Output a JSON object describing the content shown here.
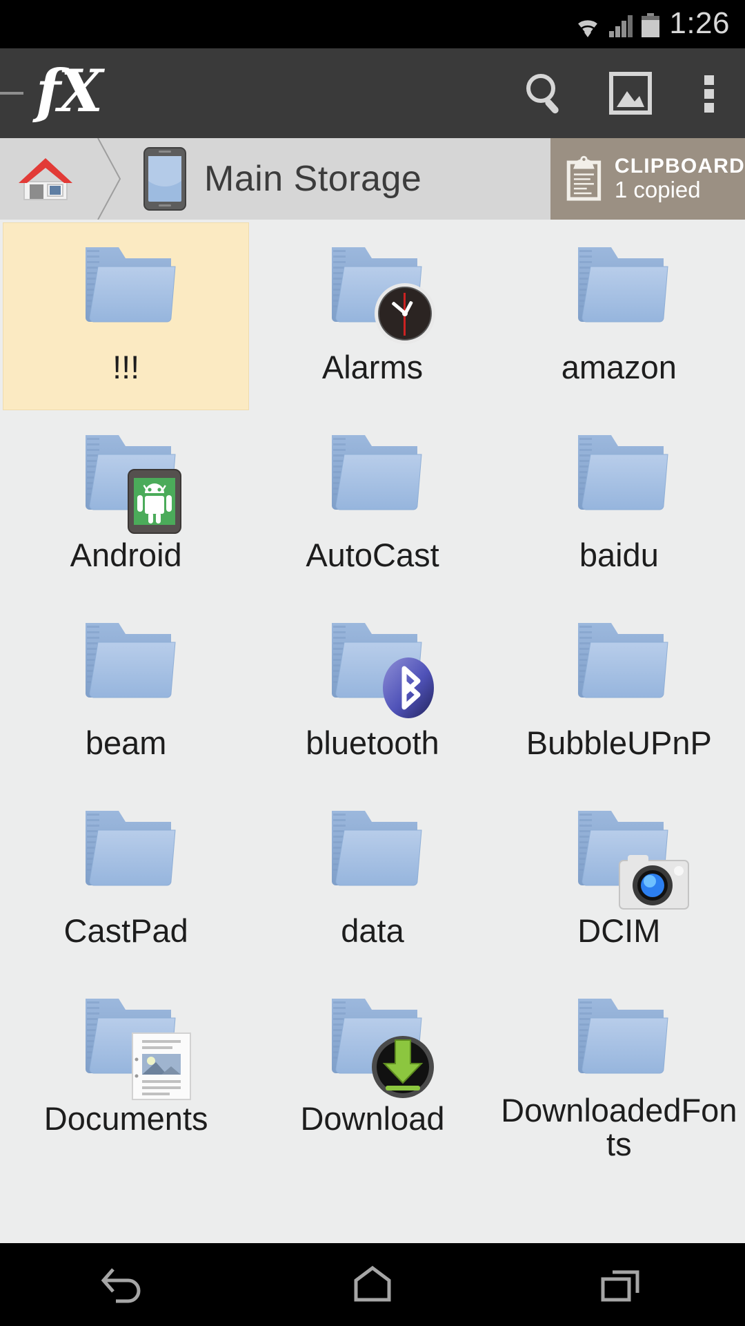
{
  "status_bar": {
    "time": "1:26",
    "icons": [
      "wifi-icon",
      "signal-icon",
      "battery-icon"
    ]
  },
  "action_bar": {
    "up_indicator": "up-dash",
    "app_logo_text": "fX",
    "actions": [
      {
        "name": "search-icon",
        "label": "Search"
      },
      {
        "name": "gallery-icon",
        "label": "Image viewer"
      },
      {
        "name": "overflow-menu-icon",
        "label": "More options"
      }
    ]
  },
  "breadcrumb": {
    "home_icon": "home-icon",
    "separator": "chevron-right-icon",
    "device_icon": "phone-icon",
    "current_path_label": "Main Storage"
  },
  "clipboard": {
    "icon": "clipboard-icon",
    "title": "CLIPBOARD",
    "subtitle": "1 copied"
  },
  "colors": {
    "status_bar_bg": "#000000",
    "action_bar_bg": "#3a3a3a",
    "breadcrumb_bg": "#d6d6d6",
    "clipboard_bg": "#9b9083",
    "grid_bg": "#eceded",
    "selection_bg": "#fbeac2",
    "folder_blue": "#a9c3e4",
    "nav_bar_bg": "#000000"
  },
  "files": [
    {
      "name": "!!!",
      "type": "folder",
      "badge": "none",
      "selected": true
    },
    {
      "name": "Alarms",
      "type": "folder",
      "badge": "clock-icon",
      "selected": false
    },
    {
      "name": "amazon",
      "type": "folder",
      "badge": "none",
      "selected": false
    },
    {
      "name": "Android",
      "type": "folder",
      "badge": "android-icon",
      "selected": false
    },
    {
      "name": "AutoCast",
      "type": "folder",
      "badge": "none",
      "selected": false
    },
    {
      "name": "baidu",
      "type": "folder",
      "badge": "none",
      "selected": false
    },
    {
      "name": "beam",
      "type": "folder",
      "badge": "none",
      "selected": false
    },
    {
      "name": "bluetooth",
      "type": "folder",
      "badge": "bluetooth-icon",
      "selected": false
    },
    {
      "name": "BubbleUPnP",
      "type": "folder",
      "badge": "none",
      "selected": false
    },
    {
      "name": "CastPad",
      "type": "folder",
      "badge": "none",
      "selected": false
    },
    {
      "name": "data",
      "type": "folder",
      "badge": "none",
      "selected": false
    },
    {
      "name": "DCIM",
      "type": "folder",
      "badge": "camera-icon",
      "selected": false
    },
    {
      "name": "Documents",
      "type": "folder",
      "badge": "document-icon",
      "selected": false
    },
    {
      "name": "Download",
      "type": "folder",
      "badge": "download-icon",
      "selected": false
    },
    {
      "name": "DownloadedFonts",
      "type": "folder",
      "badge": "none",
      "selected": false
    }
  ],
  "nav_bar": {
    "buttons": [
      {
        "name": "back-button",
        "label": "Back"
      },
      {
        "name": "home-button",
        "label": "Home"
      },
      {
        "name": "recents-button",
        "label": "Recent apps"
      }
    ]
  }
}
